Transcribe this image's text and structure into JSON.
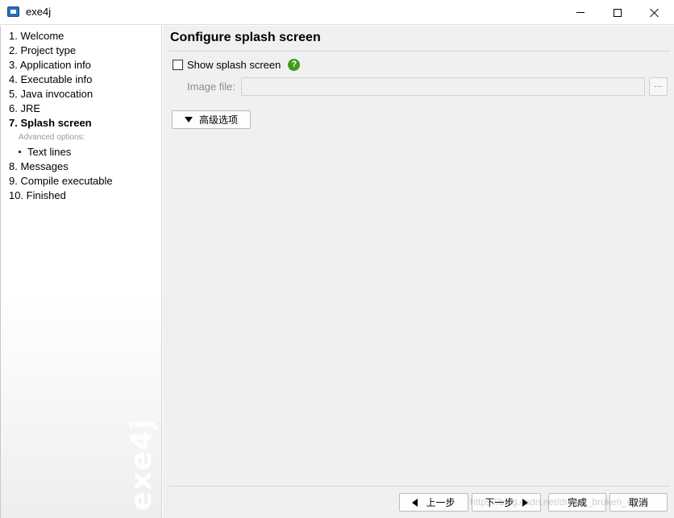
{
  "window": {
    "title": "exe4j",
    "app_icon": "exe4j-window-icon",
    "controls": [
      "minimize-icon",
      "maximize-icon",
      "close-icon"
    ]
  },
  "sidebar": {
    "steps": [
      {
        "label": "1. Welcome"
      },
      {
        "label": "2. Project type"
      },
      {
        "label": "3. Application info"
      },
      {
        "label": "4. Executable info"
      },
      {
        "label": "5. Java invocation"
      },
      {
        "label": "6. JRE"
      },
      {
        "label": "7. Splash screen",
        "active": true
      },
      {
        "label": "8. Messages"
      },
      {
        "label": "9. Compile executable"
      },
      {
        "label": "10. Finished"
      }
    ],
    "advanced_header": "Advanced options:",
    "advanced_items": [
      {
        "label": "Text lines"
      }
    ],
    "watermark": "exe4j"
  },
  "main": {
    "heading": "Configure splash screen",
    "show_splash": {
      "label": "Show splash screen",
      "checked": false,
      "help_icon": "help-question-icon",
      "help_glyph": "?"
    },
    "image_file": {
      "label": "Image file:",
      "value": "",
      "enabled": false,
      "browse_label": "···"
    },
    "advanced_button": {
      "label": "高级选项",
      "icon": "triangle-down-icon"
    }
  },
  "footer": {
    "prev_label": "上一步",
    "next_label": "下一步",
    "finish_label": "完成",
    "cancel_label": "取消",
    "site_watermark": "https://blog.csdn.net/dream_broken_eve"
  },
  "colors": {
    "help_icon": "#3f9b1e",
    "main_bg": "#f0f0f0",
    "sidebar_bg": "#ffffff"
  }
}
